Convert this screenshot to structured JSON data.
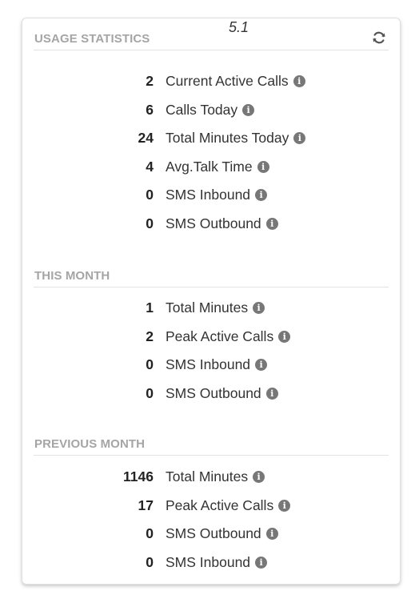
{
  "version": "5.1",
  "usage_statistics": {
    "title": "USAGE STATISTICS",
    "refresh_icon": "refresh-icon",
    "rows": [
      {
        "value": "2",
        "label": "Current Active Calls"
      },
      {
        "value": "6",
        "label": "Calls Today"
      },
      {
        "value": "24",
        "label": "Total Minutes Today"
      },
      {
        "value": "4",
        "label": "Avg.Talk Time"
      },
      {
        "value": "0",
        "label": "SMS Inbound"
      },
      {
        "value": "0",
        "label": "SMS Outbound"
      }
    ]
  },
  "this_month": {
    "title": "THIS MONTH",
    "rows": [
      {
        "value": "1",
        "label": "Total Minutes"
      },
      {
        "value": "2",
        "label": "Peak Active Calls"
      },
      {
        "value": "0",
        "label": "SMS Inbound"
      },
      {
        "value": "0",
        "label": "SMS Outbound"
      }
    ]
  },
  "previous_month": {
    "title": "PREVIOUS MONTH",
    "rows": [
      {
        "value": "1146",
        "label": "Total Minutes"
      },
      {
        "value": "17",
        "label": "Peak Active Calls"
      },
      {
        "value": "0",
        "label": "SMS Outbound"
      },
      {
        "value": "0",
        "label": "SMS Inbound"
      }
    ]
  },
  "info_glyph": "i",
  "colors": {
    "header_text": "#a5a5a5",
    "info_icon_bg": "#777777",
    "border": "#e0e0e0"
  }
}
